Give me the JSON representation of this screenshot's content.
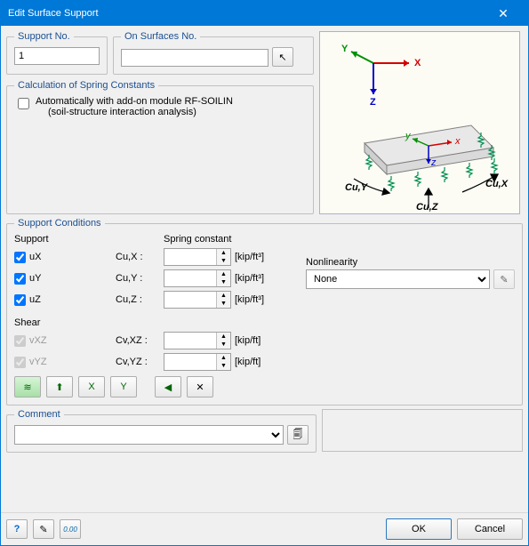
{
  "window": {
    "title": "Edit Surface Support"
  },
  "supportNo": {
    "legend": "Support No.",
    "value": "1"
  },
  "onSurfaces": {
    "legend": "On Surfaces No.",
    "value": ""
  },
  "calc": {
    "legend": "Calculation of Spring Constants",
    "checkbox_label": "Automatically with add-on module RF-SOILIN",
    "checkbox_sub": "(soil-structure interaction analysis)"
  },
  "cond": {
    "legend": "Support Conditions",
    "support_hdr": "Support",
    "spring_hdr": "Spring constant",
    "shear_hdr": "Shear",
    "rows": {
      "ux": {
        "label": "uX",
        "coef": "Cu,X :",
        "unit": "[kip/ft³]",
        "checked": true,
        "enabled": true
      },
      "uy": {
        "label": "uY",
        "coef": "Cu,Y :",
        "unit": "[kip/ft³]",
        "checked": true,
        "enabled": true
      },
      "uz": {
        "label": "uZ",
        "coef": "Cu,Z :",
        "unit": "[kip/ft³]",
        "checked": true,
        "enabled": true
      },
      "vxz": {
        "label": "vXZ",
        "coef": "Cv,XZ :",
        "unit": "[kip/ft]",
        "checked": true,
        "enabled": false
      },
      "vyz": {
        "label": "vYZ",
        "coef": "Cv,YZ :",
        "unit": "[kip/ft]",
        "checked": true,
        "enabled": false
      }
    },
    "nonlin_label": "Nonlinearity",
    "nonlin_value": "None"
  },
  "icons": {
    "pick": "↖",
    "springs": "≋",
    "p_up": "⬆",
    "p_ux": "X",
    "p_uy": "Y",
    "sound": "◀",
    "both": "✕",
    "nonlin_edit": "✎",
    "lib": "🗐",
    "help": "?",
    "det": "✎",
    "units": "0.00"
  },
  "comment": {
    "legend": "Comment",
    "value": ""
  },
  "footer": {
    "ok": "OK",
    "cancel": "Cancel"
  },
  "diagram": {
    "X": "X",
    "Y": "Y",
    "Z": "Z",
    "x": "x",
    "y": "y",
    "z": "z",
    "cux": "Cu,X",
    "cuy": "Cu,Y",
    "cuz": "Cu,Z"
  }
}
